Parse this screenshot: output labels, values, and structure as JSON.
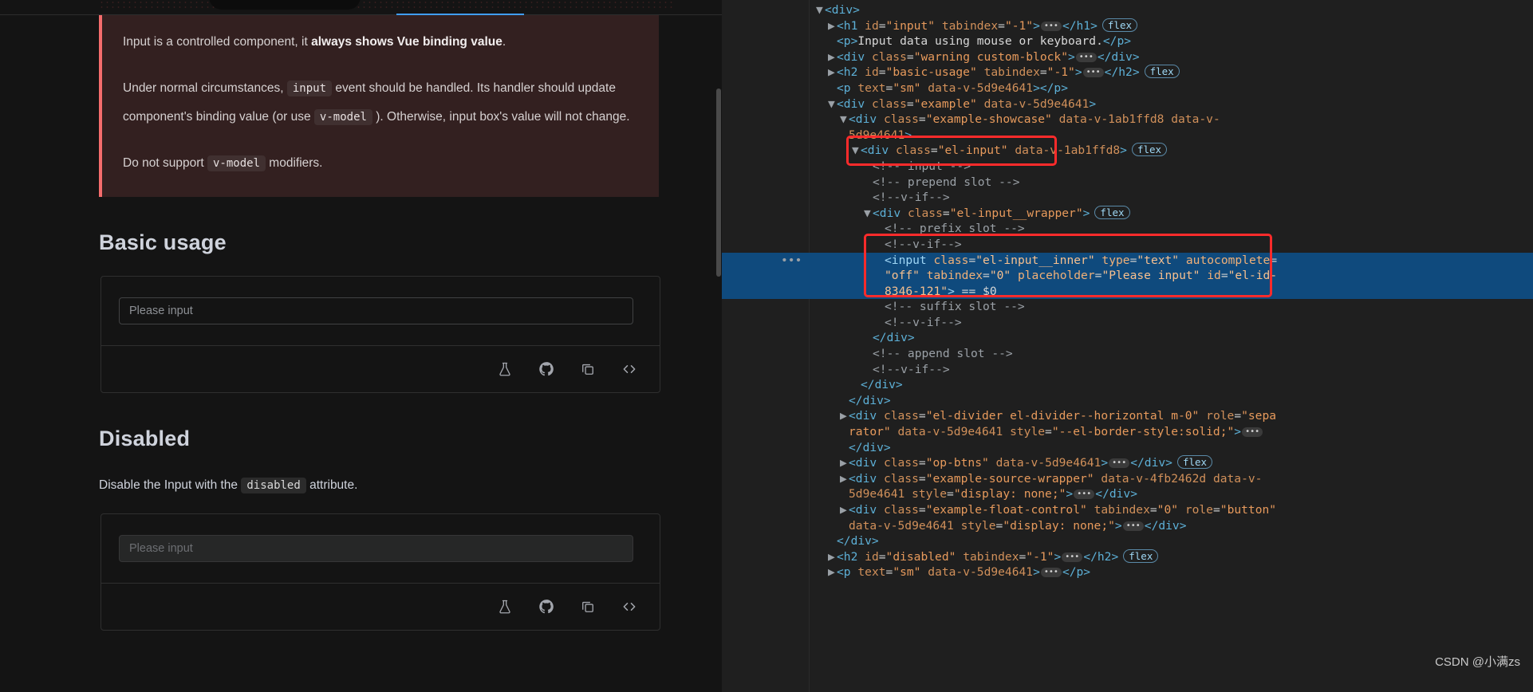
{
  "page": {
    "warning": {
      "line1_a": "Input is a controlled component, it ",
      "line1_b": "always shows Vue binding value",
      "line1_c": ".",
      "line2_a": "Under normal circumstances, ",
      "line2_code1": "input",
      "line2_b": " event should be handled. Its handler should update component's binding value (or use ",
      "line2_code2": "v-model",
      "line2_c": " ). Otherwise, input box's value will not change.",
      "line3_a": "Do not support ",
      "line3_code": "v-model",
      "line3_b": " modifiers."
    },
    "basic_usage": {
      "heading": "Basic usage",
      "input_placeholder": "Please input",
      "op_icons": [
        "flask-icon",
        "github-icon",
        "copy-icon",
        "code-icon"
      ]
    },
    "disabled": {
      "heading": "Disabled",
      "desc_a": "Disable the Input with the ",
      "desc_code": "disabled",
      "desc_b": " attribute.",
      "input_placeholder": "Please input"
    }
  },
  "devtools": {
    "watermark": "CSDN @小满zs",
    "lines": [
      {
        "id": "l1",
        "indent": 0,
        "tw": "▼",
        "html": "<span class='tag'>&lt;div&gt;</span>"
      },
      {
        "id": "l2",
        "indent": 1,
        "tw": "▶",
        "html": "<span class='tag'>&lt;h1</span> <span class='attr'>id</span>=<span class='val'>\"input\"</span> <span class='attr'>tabindex</span>=<span class='val'>\"-1\"</span><span class='tag'>&gt;</span><span class='ellip'>•••</span><span class='tag'>&lt;/h1&gt;</span><span class='badge-flex'>flex</span>"
      },
      {
        "id": "l3",
        "indent": 1,
        "tw": "",
        "html": "<span class='tag'>&lt;p&gt;</span><span class='txt'>Input data using mouse or keyboard.</span><span class='tag'>&lt;/p&gt;</span>"
      },
      {
        "id": "l4",
        "indent": 1,
        "tw": "▶",
        "html": "<span class='tag'>&lt;div</span> <span class='attr'>class</span>=<span class='val'>\"warning custom-block\"</span><span class='tag'>&gt;</span><span class='ellip'>•••</span><span class='tag'>&lt;/div&gt;</span>"
      },
      {
        "id": "l5",
        "indent": 1,
        "tw": "▶",
        "html": "<span class='tag'>&lt;h2</span> <span class='attr'>id</span>=<span class='val'>\"basic-usage\"</span> <span class='attr'>tabindex</span>=<span class='val'>\"-1\"</span><span class='tag'>&gt;</span><span class='ellip'>•••</span><span class='tag'>&lt;/h2&gt;</span><span class='badge-flex'>flex</span>"
      },
      {
        "id": "l6",
        "indent": 1,
        "tw": "",
        "html": "<span class='tag'>&lt;p</span> <span class='attr'>text</span>=<span class='val'>\"sm\"</span> <span class='attr'>data-v-5d9e4641</span><span class='tag'>&gt;&lt;/p&gt;</span>"
      },
      {
        "id": "l7",
        "indent": 1,
        "tw": "▼",
        "html": "<span class='tag'>&lt;div</span> <span class='attr'>class</span>=<span class='val'>\"example\"</span> <span class='attr'>data-v-5d9e4641</span><span class='tag'>&gt;</span>"
      },
      {
        "id": "l8",
        "indent": 2,
        "tw": "▼",
        "html": "<span class='tag'>&lt;div</span> <span class='attr'>class</span>=<span class='val'>\"example-showcase\"</span> <span class='attr'>data-v-1ab1ffd8</span> <span class='attr'>data-v-</span>"
      },
      {
        "id": "l9",
        "indent": 2,
        "tw": "",
        "html": "<span class='attr'>5d9e4641</span><span class='tag'>&gt;</span>"
      },
      {
        "id": "l10",
        "indent": 3,
        "tw": "▼",
        "html": "<span class='tag'>&lt;div</span> <span class='attr'>class</span>=<span class='val'>\"el-input\"</span> <span class='attr'>data-v-1ab1ffd8</span><span class='tag'>&gt;</span><span class='badge-flex'>flex</span>"
      },
      {
        "id": "l11",
        "indent": 4,
        "tw": "",
        "html": "<span class='cmt'>&lt;!-- input --&gt;</span>"
      },
      {
        "id": "l12",
        "indent": 4,
        "tw": "",
        "html": "<span class='cmt'>&lt;!-- prepend slot --&gt;</span>"
      },
      {
        "id": "l13",
        "indent": 4,
        "tw": "",
        "html": "<span class='cmt'>&lt;!--v-if--&gt;</span>"
      },
      {
        "id": "l14",
        "indent": 4,
        "tw": "▼",
        "html": "<span class='tag'>&lt;div</span> <span class='attr'>class</span>=<span class='val'>\"el-input__wrapper\"</span><span class='tag'>&gt;</span><span class='badge-flex'>flex</span>"
      },
      {
        "id": "l15",
        "indent": 5,
        "tw": "",
        "html": "<span class='cmt'>&lt;!-- prefix slot --&gt;</span>"
      },
      {
        "id": "l16",
        "indent": 5,
        "tw": "",
        "html": "<span class='cmt'>&lt;!--v-if--&gt;</span>"
      },
      {
        "id": "l17",
        "indent": 5,
        "tw": "",
        "sel": true,
        "dots": true,
        "html": "<span class='tag'>&lt;input</span> <span class='attr'>class</span>=<span class='val'>\"el-input__inner\"</span> <span class='attr'>type</span>=<span class='val'>\"text\"</span> <span class='attr'>autocomplete</span>="
      },
      {
        "id": "l18",
        "indent": 5,
        "tw": "",
        "sel": true,
        "html": "<span class='val'>\"off\"</span> <span class='attr'>tabindex</span>=<span class='val'>\"0\"</span> <span class='attr'>placeholder</span>=<span class='val'>\"Please input\"</span> <span class='attr'>id</span>=<span class='val'>\"el-id-</span>"
      },
      {
        "id": "l19",
        "indent": 5,
        "tw": "",
        "sel": true,
        "html": "<span class='val'>8346-121\"</span><span class='tag'>&gt;</span> <span class='dollar'>== $0</span>"
      },
      {
        "id": "l20",
        "indent": 5,
        "tw": "",
        "html": "<span class='cmt'>&lt;!-- suffix slot --&gt;</span>"
      },
      {
        "id": "l21",
        "indent": 5,
        "tw": "",
        "html": "<span class='cmt'>&lt;!--v-if--&gt;</span>"
      },
      {
        "id": "l22",
        "indent": 4,
        "tw": "",
        "html": "<span class='tag'>&lt;/div&gt;</span>"
      },
      {
        "id": "l23",
        "indent": 4,
        "tw": "",
        "html": "<span class='cmt'>&lt;!-- append slot --&gt;</span>"
      },
      {
        "id": "l24",
        "indent": 4,
        "tw": "",
        "html": "<span class='cmt'>&lt;!--v-if--&gt;</span>"
      },
      {
        "id": "l25",
        "indent": 3,
        "tw": "",
        "html": "<span class='tag'>&lt;/div&gt;</span>"
      },
      {
        "id": "l26",
        "indent": 2,
        "tw": "",
        "html": "<span class='tag'>&lt;/div&gt;</span>"
      },
      {
        "id": "l27",
        "indent": 2,
        "tw": "▶",
        "html": "<span class='tag'>&lt;div</span> <span class='attr'>class</span>=<span class='val'>\"el-divider el-divider--horizontal m-0\"</span> <span class='attr'>role</span>=<span class='val'>\"sepa</span>"
      },
      {
        "id": "l28",
        "indent": 2,
        "tw": "",
        "html": "<span class='val'>rator\"</span> <span class='attr'>data-v-5d9e4641</span> <span class='attr'>style</span>=<span class='val'>\"--el-border-style:solid;\"</span><span class='tag'>&gt;</span><span class='ellip'>•••</span>"
      },
      {
        "id": "l29",
        "indent": 2,
        "tw": "",
        "html": "<span class='tag'>&lt;/div&gt;</span>"
      },
      {
        "id": "l30",
        "indent": 2,
        "tw": "▶",
        "html": "<span class='tag'>&lt;div</span> <span class='attr'>class</span>=<span class='val'>\"op-btns\"</span> <span class='attr'>data-v-5d9e4641</span><span class='tag'>&gt;</span><span class='ellip'>•••</span><span class='tag'>&lt;/div&gt;</span><span class='badge-flex'>flex</span>"
      },
      {
        "id": "l31",
        "indent": 2,
        "tw": "▶",
        "html": "<span class='tag'>&lt;div</span> <span class='attr'>class</span>=<span class='val'>\"example-source-wrapper\"</span> <span class='attr'>data-v-4fb2462d</span> <span class='attr'>data-v-</span>"
      },
      {
        "id": "l32",
        "indent": 2,
        "tw": "",
        "html": "<span class='attr'>5d9e4641</span> <span class='attr'>style</span>=<span class='val'>\"display: none;\"</span><span class='tag'>&gt;</span><span class='ellip'>•••</span><span class='tag'>&lt;/div&gt;</span>"
      },
      {
        "id": "l33",
        "indent": 2,
        "tw": "▶",
        "html": "<span class='tag'>&lt;div</span> <span class='attr'>class</span>=<span class='val'>\"example-float-control\"</span> <span class='attr'>tabindex</span>=<span class='val'>\"0\"</span> <span class='attr'>role</span>=<span class='val'>\"button\"</span>"
      },
      {
        "id": "l34",
        "indent": 2,
        "tw": "",
        "html": "<span class='attr'>data-v-5d9e4641</span> <span class='attr'>style</span>=<span class='val'>\"display: none;\"</span><span class='tag'>&gt;</span><span class='ellip'>•••</span><span class='tag'>&lt;/div&gt;</span>"
      },
      {
        "id": "l35",
        "indent": 1,
        "tw": "",
        "html": "<span class='tag'>&lt;/div&gt;</span>"
      },
      {
        "id": "l36",
        "indent": 1,
        "tw": "▶",
        "html": "<span class='tag'>&lt;h2</span> <span class='attr'>id</span>=<span class='val'>\"disabled\"</span> <span class='attr'>tabindex</span>=<span class='val'>\"-1\"</span><span class='tag'>&gt;</span><span class='ellip'>•••</span><span class='tag'>&lt;/h2&gt;</span><span class='badge-flex'>flex</span>"
      },
      {
        "id": "l37",
        "indent": 1,
        "tw": "▶",
        "html": "<span class='tag'>&lt;p</span> <span class='attr'>text</span>=<span class='val'>\"sm\"</span> <span class='attr'>data-v-5d9e4641</span><span class='tag'>&gt;</span><span class='ellip'>•••</span><span class='tag'>&lt;/p&gt;</span>"
      }
    ]
  },
  "colors": {
    "accent": "#409eff",
    "warning_border": "#f56c6c",
    "selection": "#0f4a7d",
    "annotation": "#ff2b2b"
  }
}
